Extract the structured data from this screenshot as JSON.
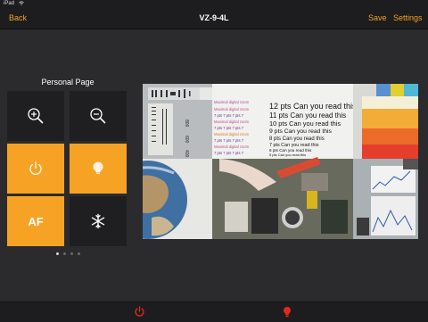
{
  "statusbar": {
    "carrier": "iPad",
    "time": "",
    "battery": ""
  },
  "navbar": {
    "back": "Back",
    "title": "VZ-9-4L",
    "save": "Save",
    "settings": "Settings"
  },
  "panel": {
    "title": "Personal Page",
    "tiles": [
      {
        "name": "zoom-in",
        "icon": "zoom-in-icon",
        "style": "dark"
      },
      {
        "name": "zoom-out",
        "icon": "zoom-out-icon",
        "style": "dark"
      },
      {
        "name": "power",
        "icon": "power-icon",
        "style": "orange"
      },
      {
        "name": "light",
        "icon": "bulb-icon",
        "style": "orange"
      },
      {
        "name": "autofocus",
        "label": "AF",
        "style": "orange"
      },
      {
        "name": "freeze",
        "icon": "snowflake-icon",
        "style": "dark"
      }
    ],
    "pager": {
      "pages": 4,
      "current": 1
    }
  },
  "preview": {
    "brand_lines": [
      "Maximal digital zoom",
      "Maximal digital zoom",
      "7 pts 7 pts 7 pts 7",
      "Maximal digital zoom",
      "7 pts 7 pts 7 pts 7",
      "Maximal digital zoom",
      "7 pts 7 pts 7 pts 7",
      "Maximal digital zoom",
      "7 pts 7 pts 7 pts 7"
    ],
    "text_lines": [
      "12 pts Can you read this",
      "11 pts Can you read this",
      "10 pts Can you read this",
      "9 pts Can you read this",
      "8 pts Can you read this",
      "7 pts Can you read this",
      "6 pts Can you read this",
      "5 pts Can you read this"
    ],
    "ruler_labels": [
      "800",
      "600",
      "400"
    ]
  },
  "bottombar": {
    "left_icon": "power-icon",
    "right_icon": "bulb-icon"
  },
  "colors": {
    "accent": "#f6a325",
    "nav_text": "#f4a11e",
    "bottom_icon": "#e8261e"
  }
}
